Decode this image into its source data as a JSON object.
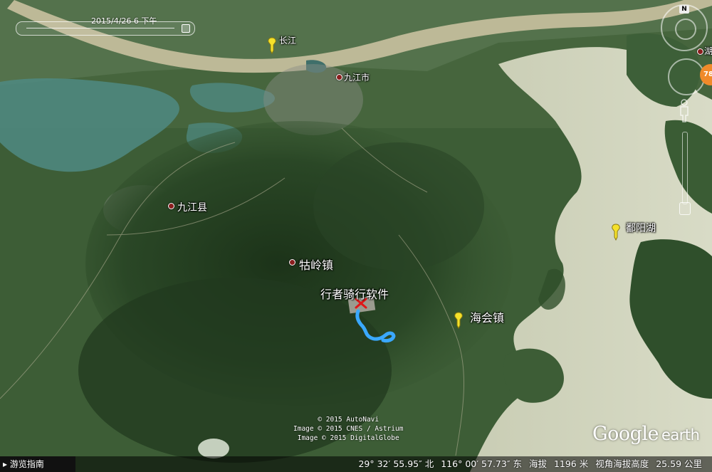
{
  "timeline": {
    "date_label": "2015/4/26    6 下午"
  },
  "places": {
    "changjiang": "长江",
    "jiujiang_city": "九江市",
    "jiujiang_county": "九江县",
    "guling": "牯岭镇",
    "haihui": "海会镇",
    "poyang": "鄱阳湖",
    "edge_label": "湖",
    "route_label": "行者骑行软件"
  },
  "attribution": [
    "© 2015 AutoNavi",
    "Image © 2015 CNES / Astrium",
    "Image © 2015 DigitalGlobe"
  ],
  "logo": {
    "google": "Google",
    "earth": "earth"
  },
  "nav": {
    "compass_letter": "N",
    "badge_value": "78"
  },
  "status": {
    "tour_guide": "游览指南",
    "lat": "29° 32′ 55.95″ 北",
    "lon": "116° 00′ 57.73″ 东",
    "elev_label": "海拔",
    "elev_value": "1196 米",
    "eye_label": "视角海拔高度",
    "eye_value": "25.59 公里"
  },
  "colors": {
    "route": "#3aa8ff",
    "pin": "#f5e12a",
    "place_dot": "#8a1e1e"
  }
}
